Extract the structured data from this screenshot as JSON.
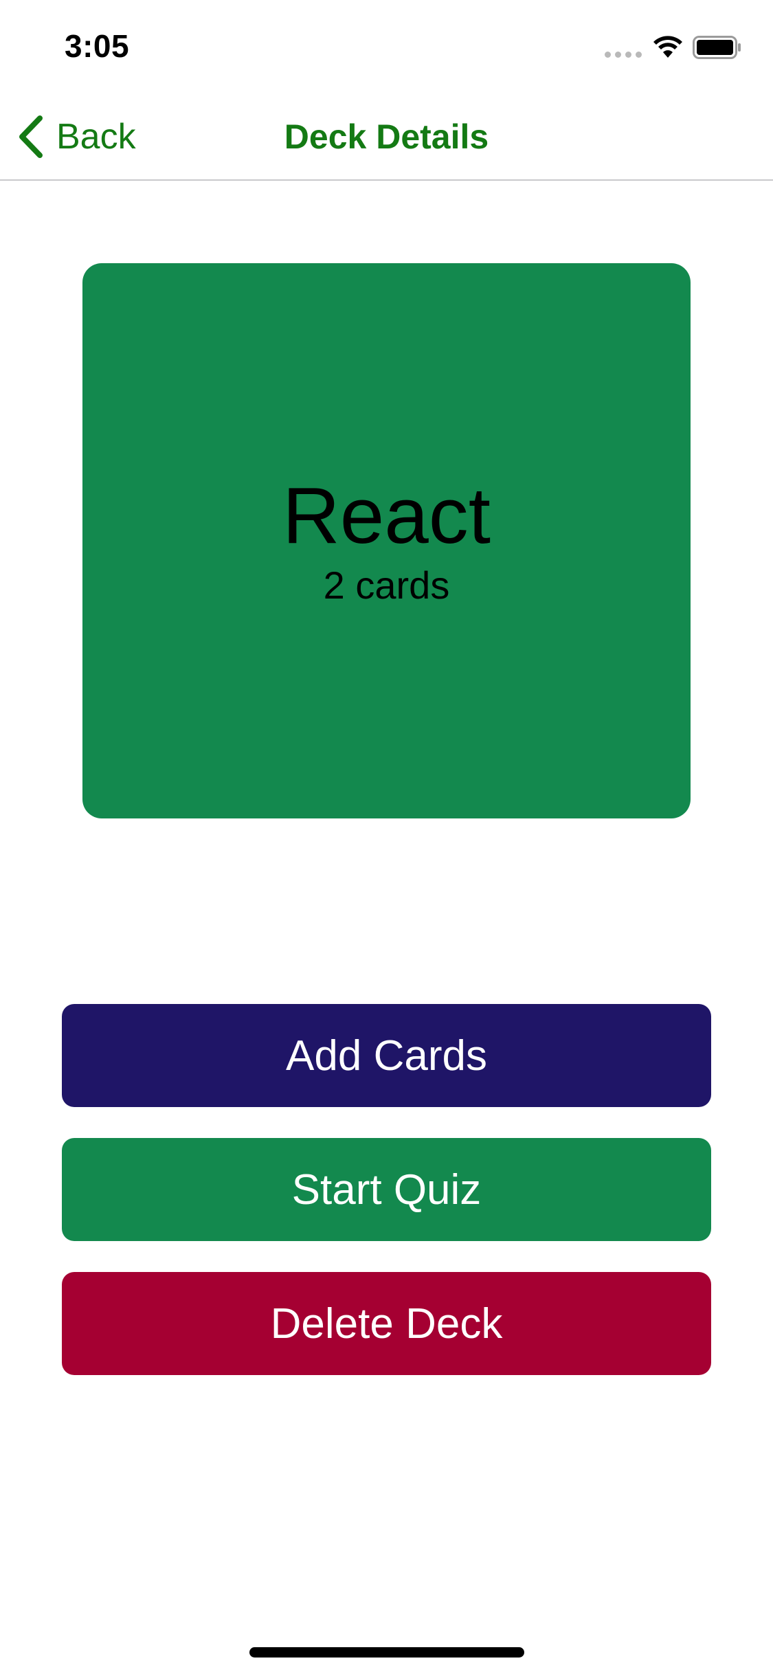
{
  "status_bar": {
    "time": "3:05",
    "signal_icon": "cellular-signal-icon",
    "wifi_icon": "wifi-icon",
    "battery_icon": "battery-icon"
  },
  "nav": {
    "back_label": "Back",
    "back_icon": "chevron-left-icon",
    "title": "Deck Details"
  },
  "deck": {
    "name": "React",
    "count_label": "2 cards"
  },
  "actions": {
    "add_cards": "Add Cards",
    "start_quiz": "Start Quiz",
    "delete_deck": "Delete Deck"
  },
  "colors": {
    "accent_green": "#147a14",
    "deck_green": "#13894e",
    "add_cards_bg": "#1f1567",
    "start_quiz_bg": "#13894e",
    "delete_deck_bg": "#a50032"
  }
}
